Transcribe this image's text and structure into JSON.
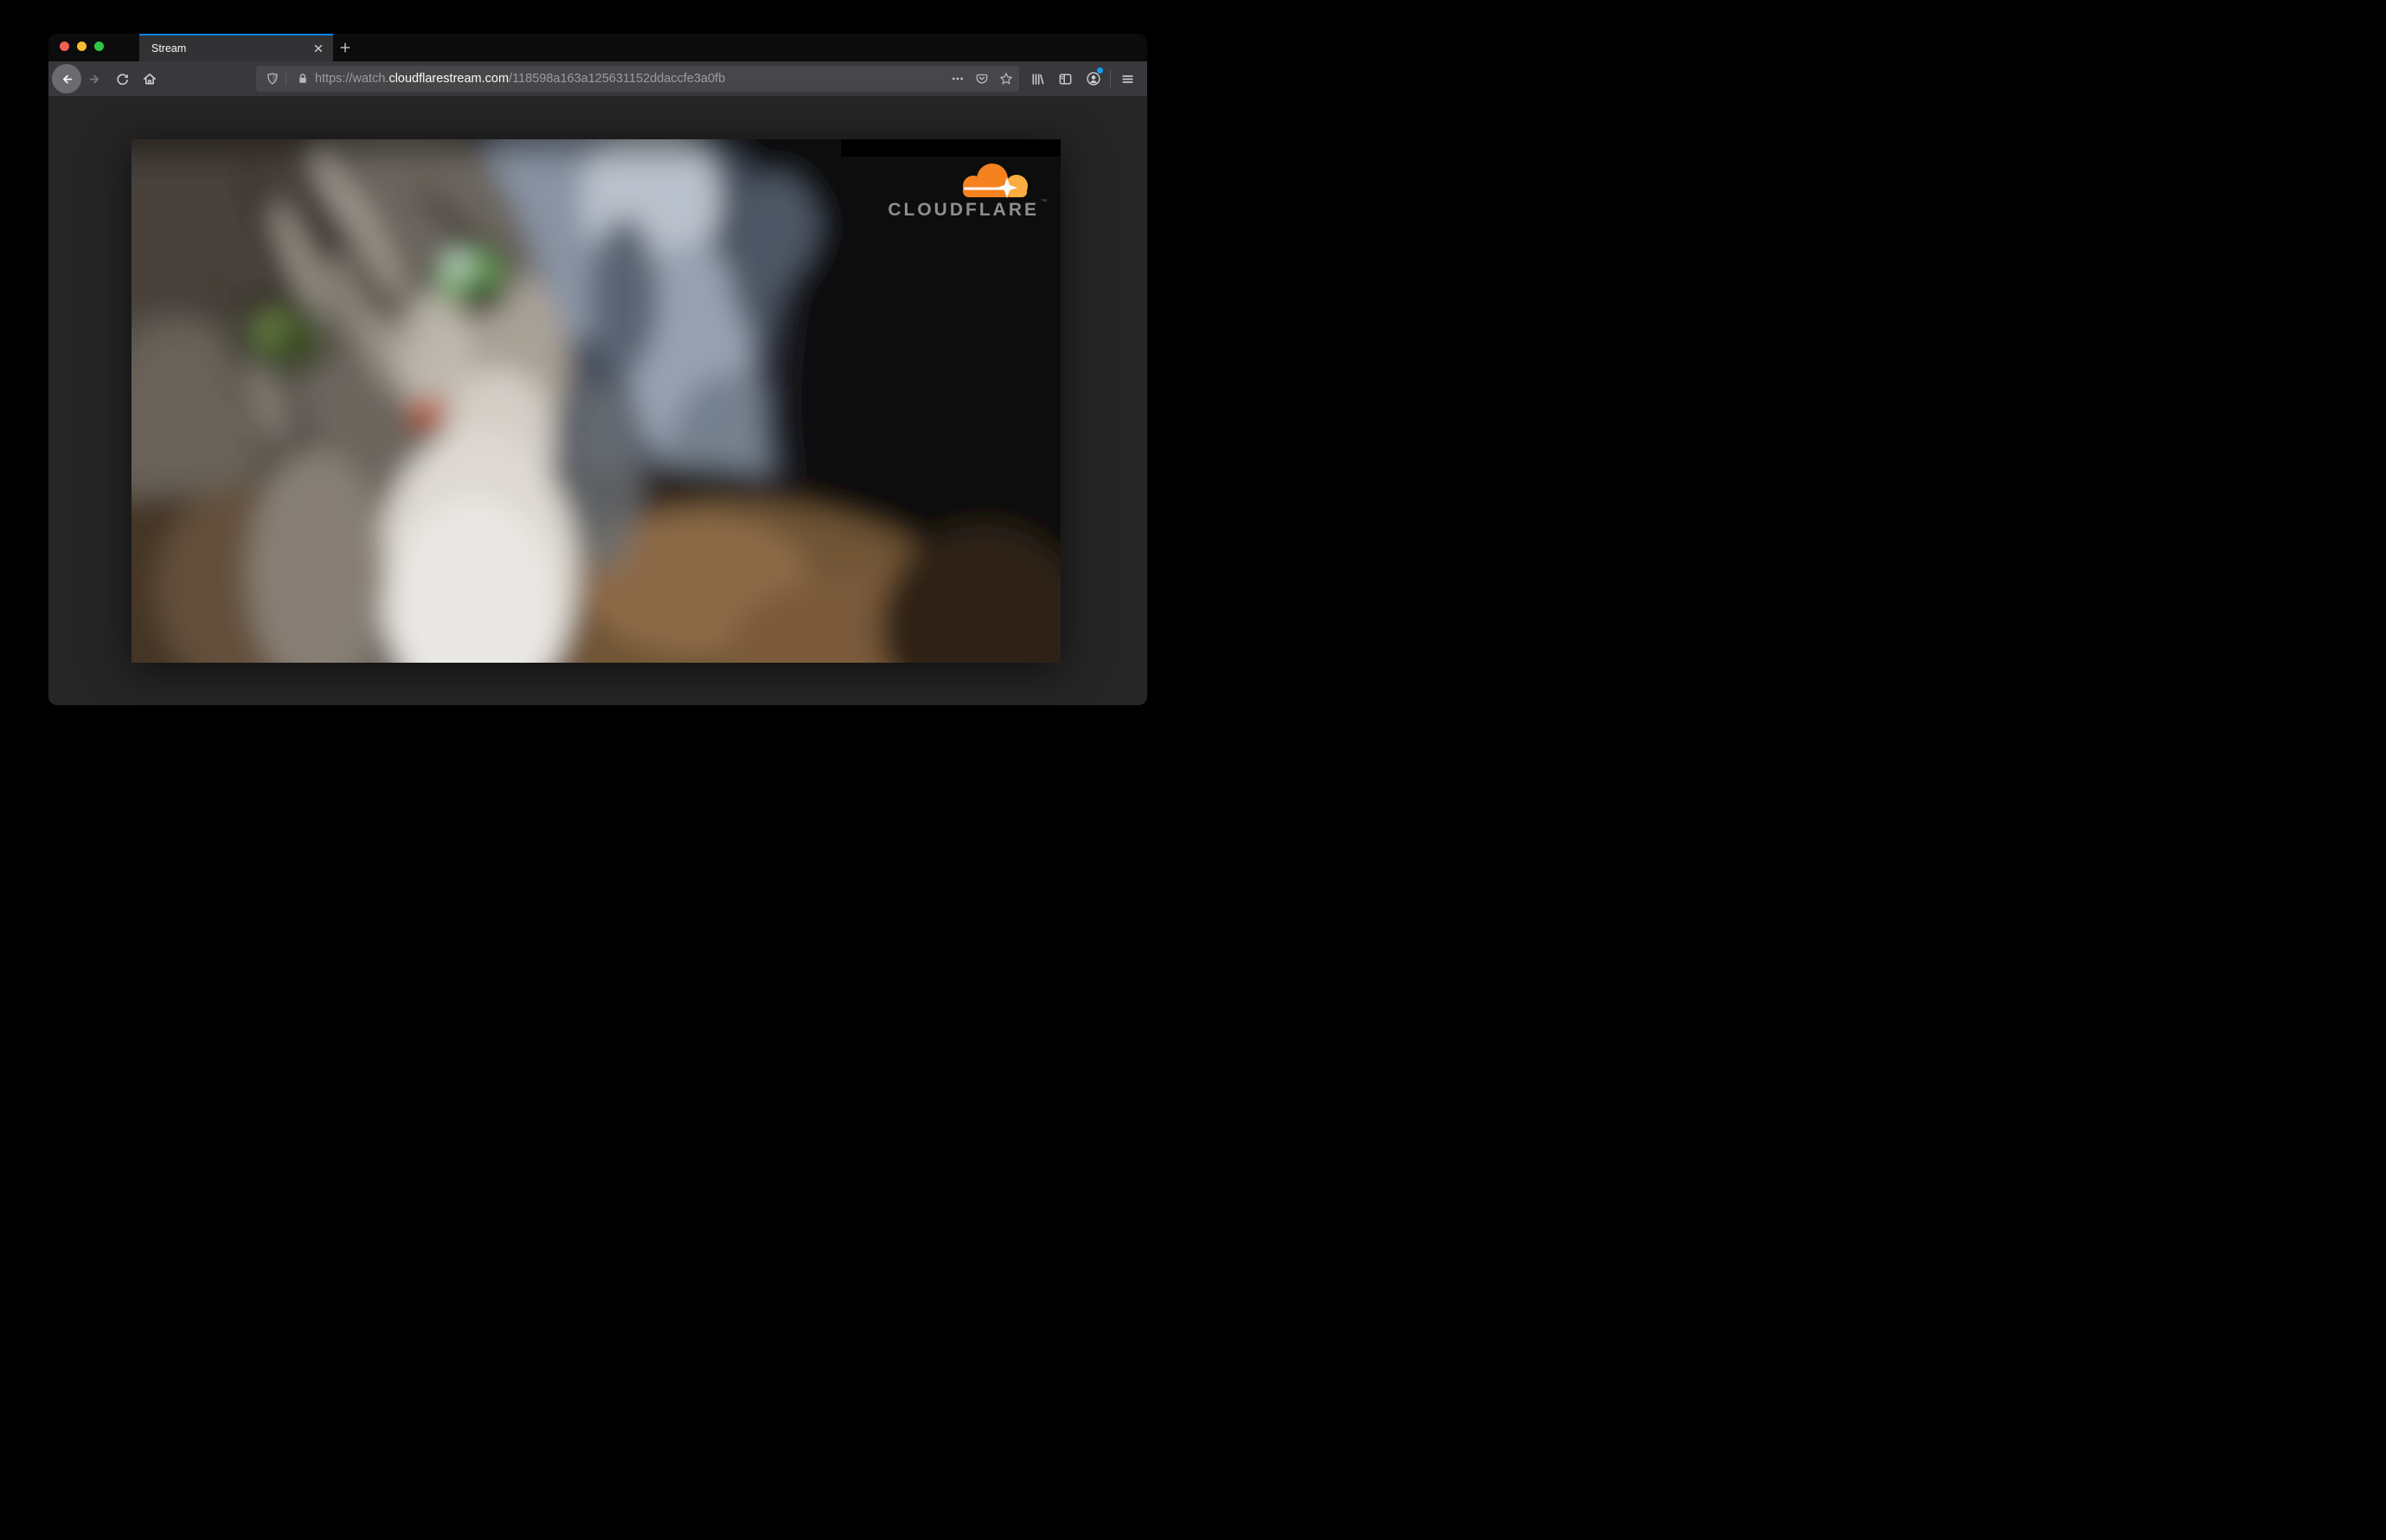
{
  "browser": {
    "tab": {
      "title": "Stream"
    },
    "address_bar": {
      "url_prefix": "https://watch.",
      "url_domain": "cloudflarestream.com",
      "url_path": "/118598a163a125631152ddaccfe3a0fb"
    },
    "icons": {
      "window_controls": [
        "close-window-icon",
        "minimize-window-icon",
        "zoom-window-icon"
      ],
      "tab_close": "close-icon",
      "new_tab": "plus-icon",
      "nav": [
        "back-icon",
        "forward-icon",
        "reload-icon",
        "home-icon"
      ],
      "urlbar_left": [
        "tracking-protection-shield-icon",
        "lock-icon"
      ],
      "urlbar_right": [
        "page-actions-ellipsis-icon",
        "pocket-icon",
        "bookmark-star-icon"
      ],
      "toolbar_right": [
        "library-icon",
        "sidebar-icon",
        "account-icon",
        "menu-hamburger-icon"
      ],
      "account_has_notification_dot": true
    }
  },
  "video_player": {
    "watermark_text": "CLOUDFLARE",
    "watermark_trademark": "™",
    "subject": "blurred close-up of a gray tabby cat with green eyes"
  },
  "colors": {
    "tab_accent_blue": "#0a84ff",
    "traffic_red": "#f35f55",
    "traffic_yellow": "#f5bd2f",
    "traffic_green": "#2fc844",
    "notification_dot_blue": "#0f9fef",
    "cloudflare_orange": "#f6821f",
    "cloudflare_orange_light": "#fbad41",
    "tabbar_bg": "#0c0c0d",
    "toolbar_bg": "#38383d",
    "urlbar_bg": "#474749",
    "content_bg": "#262626"
  }
}
